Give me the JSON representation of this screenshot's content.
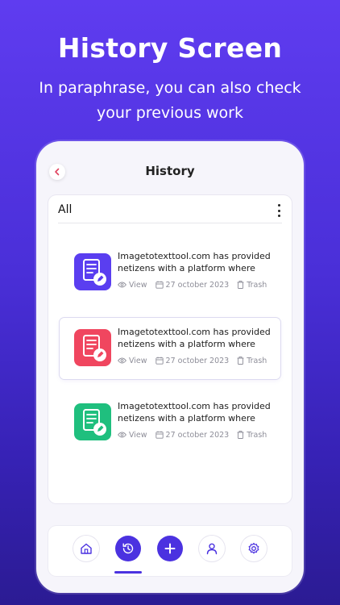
{
  "promo": {
    "title": "History Screen",
    "subtitle_line1": "In paraphrase, you can also check",
    "subtitle_line2": "your previous work"
  },
  "screen": {
    "title": "History",
    "filter": "All"
  },
  "history_items": [
    {
      "text_line1": "Imagetotexttool.com has provided",
      "text_line2": "netizens with a platform where",
      "view_label": "View",
      "date": "27 october 2023",
      "trash_label": "Trash",
      "icon": "document-edit-icon",
      "color": "#5a3ef0"
    },
    {
      "text_line1": "Imagetotexttool.com has provided",
      "text_line2": "netizens with a platform where",
      "view_label": "View",
      "date": "27 october 2023",
      "trash_label": "Trash",
      "icon": "document-edit-icon",
      "color": "#f0465f"
    },
    {
      "text_line1": "Imagetotexttool.com has provided",
      "text_line2": "netizens with a platform where",
      "view_label": "View",
      "date": "27 october 2023",
      "trash_label": "Trash",
      "icon": "document-edit-icon",
      "color": "#1fbf7e"
    }
  ],
  "bottom_nav": {
    "items": [
      "home-icon",
      "history-icon",
      "add-icon",
      "profile-icon",
      "settings-icon"
    ],
    "active": "history-icon",
    "accent": "#4b32e0"
  },
  "colors": {
    "background_top": "#5f3cf0",
    "background_bottom": "#2b1b93",
    "back_arrow": "#e0435f"
  }
}
